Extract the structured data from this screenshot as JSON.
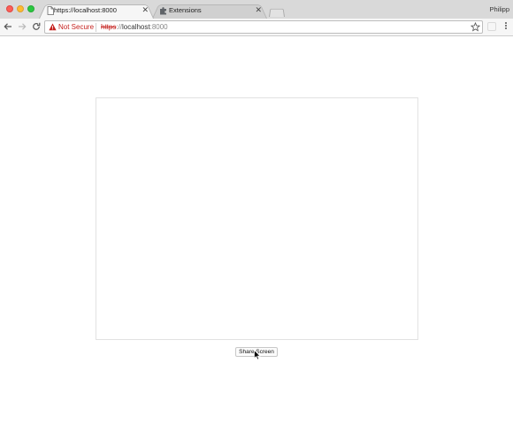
{
  "window": {
    "profile_name": "Philipp"
  },
  "tabs": [
    {
      "title": "https://localhost:8000",
      "icon": "page-icon",
      "active": true
    },
    {
      "title": "Extensions",
      "icon": "puzzle-icon",
      "active": false
    }
  ],
  "toolbar": {
    "security_label": "Not Secure",
    "url_scheme": "https",
    "url_separator": "://",
    "url_host": "localhost",
    "url_port": ":8000"
  },
  "page": {
    "share_button_label": "Share Screen"
  },
  "colors": {
    "warning_red": "#c5221f",
    "tab_active": "#f6f6f6",
    "tab_inactive": "#d0d0d0"
  }
}
